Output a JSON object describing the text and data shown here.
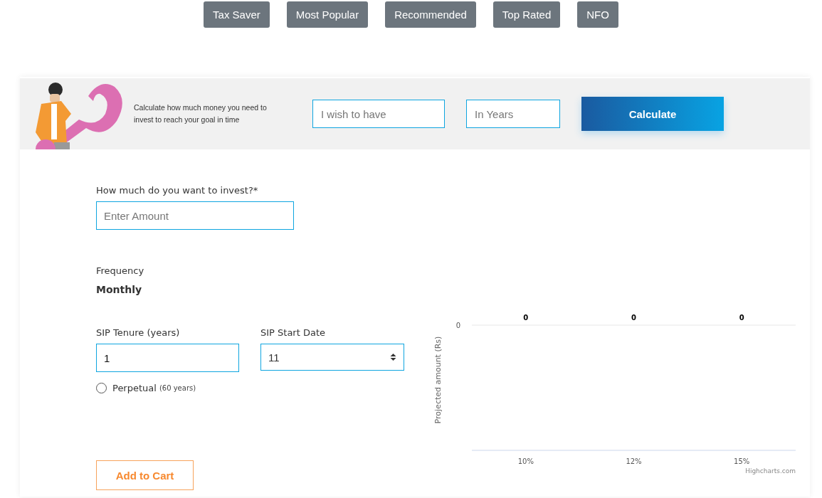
{
  "tabs": [
    {
      "label": "Tax Saver"
    },
    {
      "label": "Most Popular"
    },
    {
      "label": "Recommended"
    },
    {
      "label": "Top Rated"
    },
    {
      "label": "NFO"
    }
  ],
  "goal_banner": {
    "text": "Calculate how much money you need to invest to reach your goal in time",
    "amount_placeholder": "I wish to have",
    "years_placeholder": "In Years",
    "button": "Calculate"
  },
  "form": {
    "amount_label": "How much do you want to invest?*",
    "amount_placeholder": "Enter Amount",
    "frequency_label": "Frequency",
    "frequency_value": "Monthly",
    "tenure_label": "SIP Tenure (years)",
    "tenure_value": "1",
    "start_date_label": "SIP Start Date",
    "start_date_value": "11",
    "perpetual": {
      "label": "Perpetual",
      "note": "(60 years)",
      "selected": false
    },
    "add_to_cart": "Add to Cart"
  },
  "chart": {
    "y_axis_title": "Projected amount (Rs)",
    "y_axis_label": "0",
    "bar_labels": [
      "0",
      "0",
      "0"
    ],
    "categories": [
      "10%",
      "12%",
      "15%"
    ],
    "credit": "Highcharts.com"
  }
}
